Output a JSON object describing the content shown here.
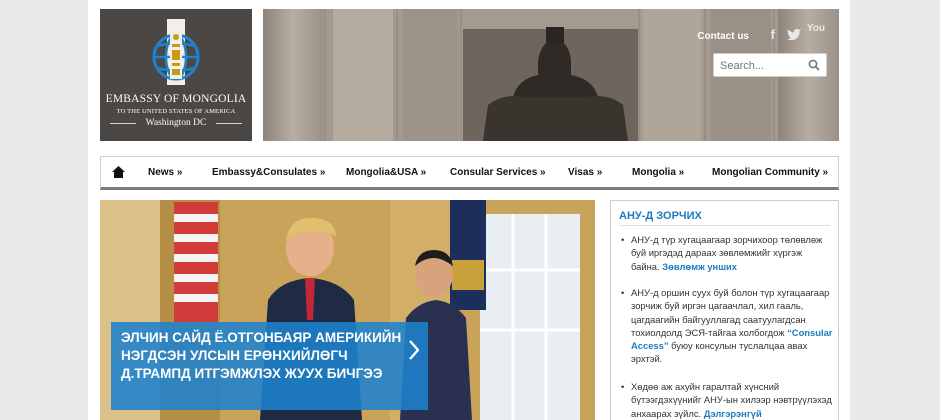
{
  "logo": {
    "line1": "EMBASSY OF MONGOLIA",
    "line2": "TO THE UNITED STATES OF AMERICA",
    "line3": "Washington DC"
  },
  "header": {
    "contact_label": "Contact us",
    "social": {
      "facebook": "f",
      "youtube": "You"
    },
    "search_placeholder": "Search..."
  },
  "nav": {
    "home_icon": "home-icon",
    "items": [
      "News »",
      "Embassy&Consulates »",
      "Mongolia&USA »",
      "Consular Services »",
      "Visas »",
      "Mongolia »",
      "Mongolian Community »"
    ]
  },
  "slider": {
    "caption": "ЭЛЧИН САЙД Ё.ОТГОНБАЯР АМЕРИКИЙН НЭГДСЭН УЛСЫН ЕРӨНХИЙЛӨГЧ Д.ТРАМПД ИТГЭМЖЛЭХ ЖУУХ БИЧГЭЭ",
    "arrow_icon": "chevron-right-icon"
  },
  "sidebar": {
    "title": "АНУ-Д ЗОРЧИХ",
    "items": [
      {
        "text": "АНУ-д түр хугацаагаар зорчихоор төлөвлөж буй иргэдэд дараах зөвлөмжийг хүргэж байна.",
        "link": "Зөвлөмж унших",
        "after": ""
      },
      {
        "text": "АНУ-д оршин суух буй болон түр хугацаагаар зорчиж буй иргэн цагаачлал, хил гааль, цагдаагийн байгууллагад саатуулагдсан тохиолдолд ЭСЯ-тайгаа холбогдож",
        "link": "“Consular Access”",
        "after": "буюу консулын туслалцаа авах эрхтэй."
      },
      {
        "text": "Хөдөө аж ахуйн гаралтай хүнсний бүтээгдэхүүнийг АНУ-ын хилээр нэвтрүүлэхэд анхаарах зүйлс.",
        "link": "Дэлгэрэнгүй",
        "after": ""
      }
    ]
  },
  "colors": {
    "accent": "#1d7ac0",
    "logo_bg": "#4a4745",
    "caption_bg": "#1e82cd"
  }
}
